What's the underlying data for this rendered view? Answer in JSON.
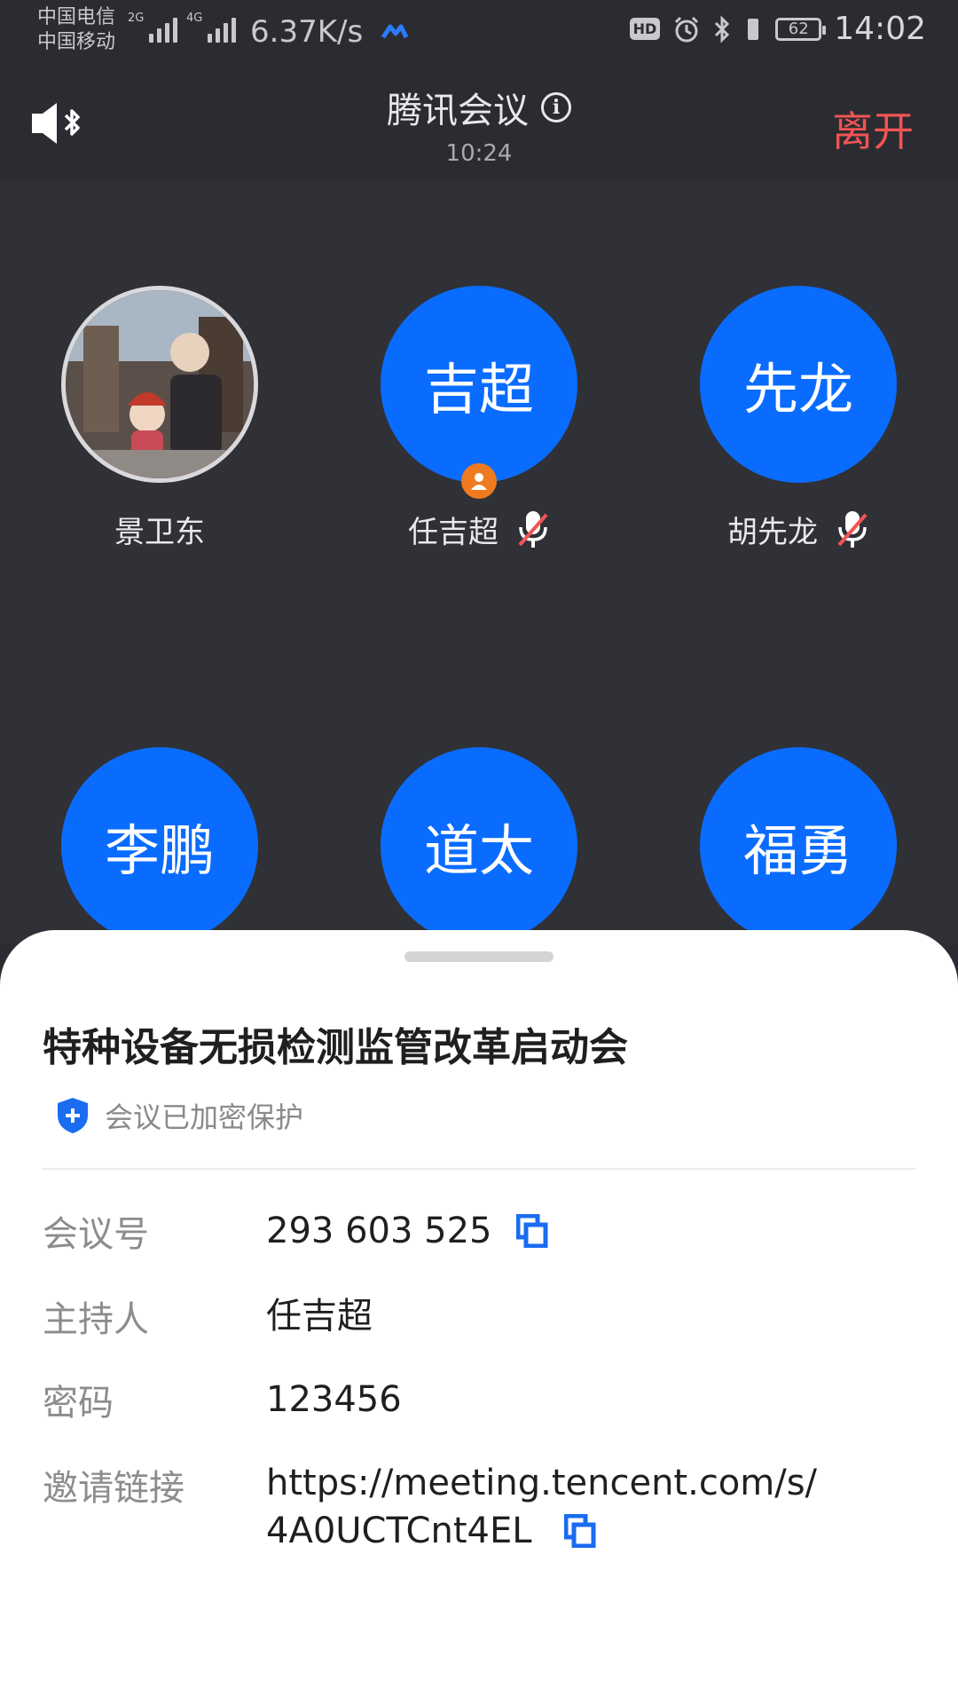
{
  "status_bar": {
    "carrier_1": "中国电信",
    "carrier_2": "中国移动",
    "net_1": "2G",
    "net_2": "4G",
    "speed": "6.37K/s",
    "hd_badge": "HD",
    "battery": "62",
    "time": "14:02"
  },
  "header": {
    "title": "腾讯会议",
    "info_symbol": "i",
    "timer": "10:24",
    "leave_label": "离开"
  },
  "participants": [
    {
      "avatar_text": "",
      "name": "景卫东",
      "muted": false,
      "is_host": false
    },
    {
      "avatar_text": "吉超",
      "name": "任吉超",
      "muted": true,
      "is_host": true
    },
    {
      "avatar_text": "先龙",
      "name": "胡先龙",
      "muted": true,
      "is_host": false
    },
    {
      "avatar_text": "李鹏",
      "name": "",
      "muted": false,
      "is_host": false
    },
    {
      "avatar_text": "道太",
      "name": "",
      "muted": false,
      "is_host": false
    },
    {
      "avatar_text": "福勇",
      "name": "",
      "muted": false,
      "is_host": false
    }
  ],
  "meeting_info": {
    "title": "特种设备无损检测监管改革启动会",
    "encryption": "会议已加密保护",
    "meeting_id_label": "会议号",
    "meeting_id": "293 603 525",
    "host_label": "主持人",
    "host": "任吉超",
    "password_label": "密码",
    "password": "123456",
    "invite_label": "邀请链接",
    "invite_link": "https://meeting.tencent.com/s/4A0UCTCnt4EL"
  },
  "colors": {
    "avatar_blue": "#0a6cff",
    "leave_red": "#f25454",
    "copy_blue": "#1a6cf0",
    "host_orange": "#f07a20"
  }
}
